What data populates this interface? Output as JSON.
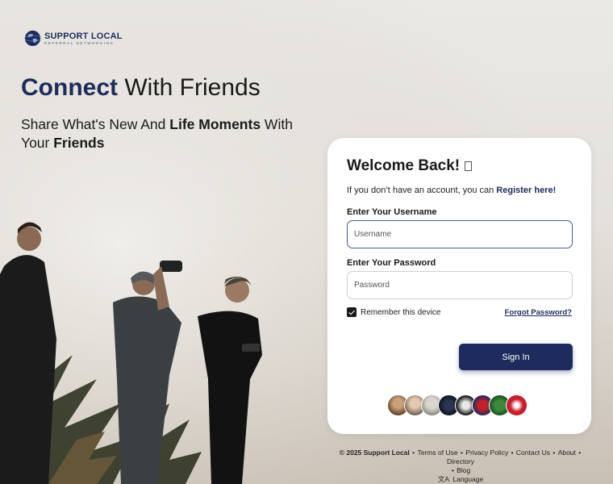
{
  "brand": {
    "name": "SUPPORT LOCAL",
    "tagline": "REFERRAL NETWORKING"
  },
  "hero": {
    "headline_accent": "Connect",
    "headline_rest": " With Friends",
    "sub_part1": "Share What's New And ",
    "sub_bold1": "Life Moments",
    "sub_part2": " With Your ",
    "sub_bold2": "Friends"
  },
  "login": {
    "title": "Welcome Back!",
    "no_account_text": "If you don’t have an account, you can ",
    "register_link": "Register here!",
    "username_label": "Enter Your Username",
    "username_placeholder": "Username",
    "username_value": "",
    "password_label": "Enter Your Password",
    "password_placeholder": "Password",
    "password_value": "",
    "remember_label": "Remember this device",
    "remember_checked": true,
    "forgot_link": "Forgot Password?",
    "signin_label": "Sign In"
  },
  "footer": {
    "copyright": "© 2025 Support Local",
    "links": [
      "Terms of Use",
      "Privacy Policy",
      "Contact Us",
      "About",
      "Directory",
      "Blog"
    ],
    "language": "Language"
  },
  "colors": {
    "brand_navy": "#1d2c5c",
    "card_bg": "#ffffff",
    "page_bg": "#e6e3de"
  }
}
